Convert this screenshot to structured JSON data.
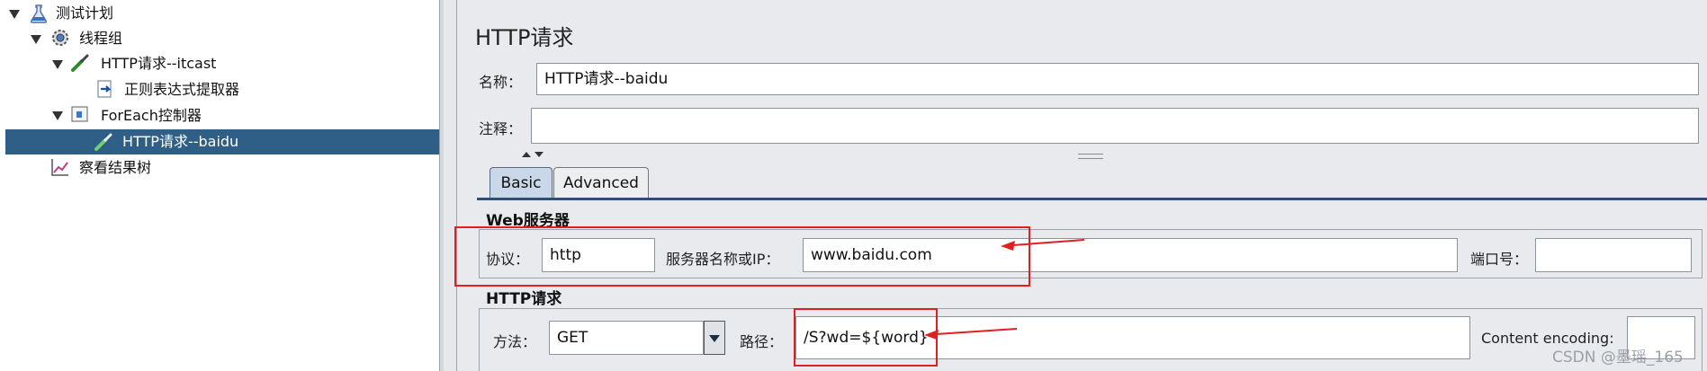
{
  "tree": {
    "items": [
      {
        "label": "测试计划"
      },
      {
        "label": "线程组"
      },
      {
        "label": "HTTP请求--itcast"
      },
      {
        "label": "正则表达式提取器"
      },
      {
        "label": "ForEach控制器"
      },
      {
        "label": "HTTP请求--baidu"
      },
      {
        "label": "察看结果树"
      }
    ]
  },
  "panel": {
    "title": "HTTP请求",
    "name_label": "名称：",
    "name_value": "HTTP请求--baidu",
    "comment_label": "注释：",
    "comment_value": "",
    "tabs": [
      {
        "label": "Basic"
      },
      {
        "label": "Advanced"
      }
    ],
    "web_server": {
      "title": "Web服务器",
      "protocol_label": "协议：",
      "protocol_value": "http",
      "server_label": "服务器名称或IP：",
      "server_value": "www.baidu.com",
      "port_label": "端口号：",
      "port_value": ""
    },
    "http_request": {
      "title": "HTTP请求",
      "method_label": "方法：",
      "method_value": "GET",
      "path_label": "路径：",
      "path_value": "/S?wd=${word}",
      "encoding_label": "Content encoding:",
      "encoding_value": ""
    }
  },
  "watermark": "CSDN @墨瑶_165",
  "colors": {
    "selection": "#2f5f86",
    "highlight": "#e02020",
    "panel_bg": "#e8eaed"
  }
}
